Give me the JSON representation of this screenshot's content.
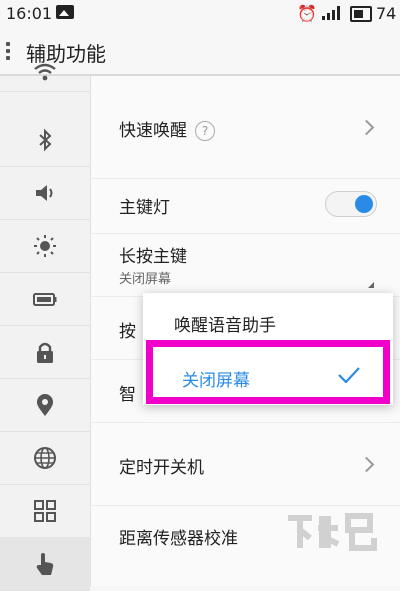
{
  "status_bar": {
    "time": "16:01",
    "battery_level": "74",
    "image_icon": "picture-icon",
    "alarm_icon": "alarm-icon",
    "signal_icon": "signal-icon",
    "battery_icon": "battery-icon"
  },
  "header": {
    "title": "辅助功能",
    "menu_icon": "menu-dots-icon"
  },
  "sidebar": {
    "items": [
      {
        "icon": "wifi-icon"
      },
      {
        "icon": "bluetooth-icon"
      },
      {
        "icon": "volume-icon"
      },
      {
        "icon": "brightness-icon"
      },
      {
        "icon": "battery-icon"
      },
      {
        "icon": "lock-icon"
      },
      {
        "icon": "location-icon"
      },
      {
        "icon": "globe-icon"
      },
      {
        "icon": "apps-grid-icon"
      },
      {
        "icon": "hand-pointer-icon",
        "active": true
      }
    ]
  },
  "settings": {
    "quick_wake": {
      "label": "快速唤醒",
      "help": "?"
    },
    "home_key_light": {
      "label": "主键灯",
      "enabled": true
    },
    "long_press_home": {
      "label": "长按主键",
      "value": "关闭屏幕"
    },
    "row4_label_visible": "按",
    "row5_label_visible": "智",
    "scheduled_power": {
      "label": "定时开关机"
    },
    "proximity_calibration": {
      "label": "距离传感器校准"
    }
  },
  "popup": {
    "options": [
      {
        "label": "唤醒语音助手",
        "selected": false
      },
      {
        "label": "关闭屏幕",
        "selected": true
      }
    ],
    "highlight_color": "#f000c8",
    "accent_color": "#2a8be6"
  },
  "watermark": {
    "text": "下载吧"
  }
}
